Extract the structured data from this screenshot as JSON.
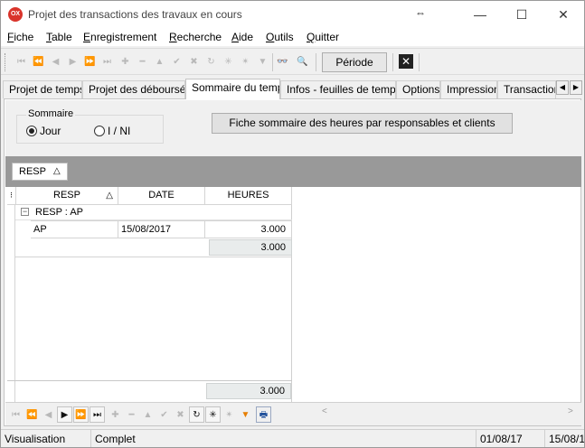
{
  "window": {
    "app_icon_text": "OX",
    "title": "Projet des transactions des travaux en cours",
    "move_glyph": "⇔",
    "minimize_glyph": "—",
    "maximize_glyph": "☐",
    "close_glyph": "✕"
  },
  "menu": {
    "items": [
      {
        "u": "F",
        "rest": "iche"
      },
      {
        "u": "T",
        "rest": "able"
      },
      {
        "u": "E",
        "rest": "nregistrement"
      },
      {
        "u": "R",
        "rest": "echerche"
      },
      {
        "u": "A",
        "rest": "ide"
      },
      {
        "u": "O",
        "rest": "utils"
      },
      {
        "u": "Q",
        "rest": "uitter"
      }
    ]
  },
  "toolbar": {
    "icons": {
      "first": "⏮",
      "prev_page": "⏪",
      "prev": "◀",
      "next": "▶",
      "next_page": "⏩",
      "last": "⏭",
      "insert": "✚",
      "delete": "━",
      "edit": "▲",
      "post": "✔",
      "cancel": "✖",
      "refresh": "↻",
      "bookmark": "✳",
      "goto_bookmark": "✴",
      "filter": "▼",
      "binoculars": "👓",
      "search": "🔍",
      "close": "✕"
    },
    "periode_label": "Période"
  },
  "tabs": {
    "items": [
      "Projet de temps",
      "Projet des déboursés",
      "Sommaire du temps",
      "Infos - feuilles de temps",
      "Options",
      "Impression",
      "Transaction"
    ],
    "active_index": 2,
    "scroll_left": "◀",
    "scroll_right": "▶"
  },
  "sommaire": {
    "group_title": "Sommaire",
    "radio_jour": "Jour",
    "radio_ini": "I / NI",
    "selected": "Jour",
    "fiche_button": "Fiche sommaire des heures par responsables et clients"
  },
  "groupby": {
    "chip_label": "RESP",
    "sort_glyph": "△"
  },
  "grid": {
    "indicator_glyph": "⁝",
    "columns": [
      "RESP",
      "DATE",
      "HEURES"
    ],
    "sort_glyph": "△",
    "group_row_label": "RESP : AP",
    "collapse_glyph": "−",
    "rows": [
      {
        "resp": "AP",
        "date": "15/08/2017",
        "heures": "3.000"
      }
    ],
    "group_subtotal": "3.000",
    "grand_total": "3.000"
  },
  "navigator": {
    "icons": {
      "first": "⏮",
      "prev_page": "⏪",
      "prev": "◀",
      "next": "▶",
      "next_page": "⏩",
      "last": "⏭",
      "insert": "✚",
      "delete": "━",
      "edit": "▲",
      "post": "✔",
      "cancel": "✖",
      "refresh": "↻",
      "bookmark": "✳",
      "goto_bookmark": "✴",
      "filter": "▼",
      "print": "🖶"
    },
    "scroll_left": "<",
    "scroll_right": ">"
  },
  "statusbar": {
    "mode": "Visualisation",
    "state": "Complet",
    "date_from": "01/08/17",
    "date_to": "15/08/1"
  }
}
